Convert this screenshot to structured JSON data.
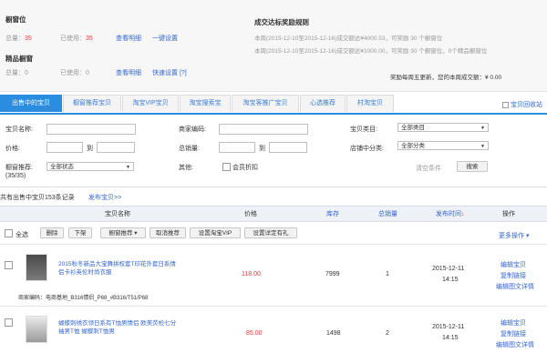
{
  "top": {
    "stock_title": "橱窗位",
    "stock_total_label": "总量：",
    "stock_total": "35",
    "stock_used_label": "已使用：",
    "stock_used": "35",
    "stock_view": "查看明细",
    "stock_setup": "一键设置",
    "featured_title": "精品橱窗",
    "featured_total_label": "总量：",
    "featured_total": "0",
    "featured_used_label": "已使用：",
    "featured_used": "0",
    "featured_view": "查看明细",
    "featured_setup": "快速设置 [?]",
    "reward_title": "成交达标奖励规则",
    "reward_line1": "本周(2015-12-10至2015-12-16)成交额达¥4000.53，可奖励 30 个橱窗位",
    "reward_line2": "本周(2015-12-10至2015-12-16)成交额达¥1000.00，可奖励 30 个橱窗位，0个精品橱窗位",
    "reward_footer": "奖励每周五更新，您的本周成交额：¥ 0.00"
  },
  "tabs": [
    "出售中的宝贝",
    "橱窗推荐宝贝",
    "淘宝VIP宝贝",
    "淘宝搜索宝",
    "淘宝客推广宝贝",
    "心选推荐",
    "村淘宝贝"
  ],
  "tab_right": "宝贝回收站",
  "filters": {
    "name_label": "宝贝名称:",
    "code_label": "商家编码:",
    "category_label": "宝贝类目:",
    "category_value": "全部类目",
    "price_label": "价格:",
    "total_sales_label": "总销量:",
    "to1": "到",
    "to2": "到",
    "shop_cat_label": "店铺中分类:",
    "shop_cat_value": "全部分类",
    "window_label": "橱窗推荐:",
    "window_value": "全部状态",
    "window_count": "(35/35)",
    "other_label": "其他:",
    "member_discount": "会员折扣",
    "clear": "清空条件",
    "search": "搜索"
  },
  "summary": {
    "count_text": "共有出售中宝贝153条记录",
    "publish_link": "发布宝贝>>"
  },
  "table": {
    "headers": [
      "宝贝名称",
      "价格",
      "库存",
      "总销量",
      "发布时间",
      "操作"
    ],
    "sort_arrow": "↓",
    "select_all": "全选",
    "delete": "删除",
    "delist": "下架",
    "window_rec": "橱窗推荐",
    "cancel_rec": "取消推荐",
    "set_vip": "设置淘宝VIP",
    "set_gift": "设置详定有礼",
    "more_ops": "更多操作",
    "rows": [
      {
        "title": "2015秋冬新品大宝舞拼权套T印花外套日系情侣卡衫英伦时尚衣服",
        "code": "商家编码：电商基地_B316情侣_P68_#B316/T51/P68",
        "price": "118.00",
        "stock": "7999",
        "sales": "1",
        "date": "2015-12-11",
        "time": "14:15",
        "ops": [
          "编辑宝贝",
          "复制链接",
          "编辑图文详情"
        ]
      },
      {
        "title": "蝴蝶刺绣衣领日系有T恤男情侣 欧美荧检七分袖男T恤 蝴蝶刺T恤男",
        "code": "",
        "price": "85.00",
        "stock": "1498",
        "sales": "2",
        "date": "2015-12-11",
        "time": "14:15",
        "ops": [
          "编辑宝贝",
          "复制链接",
          "编辑图文详情"
        ]
      }
    ]
  }
}
